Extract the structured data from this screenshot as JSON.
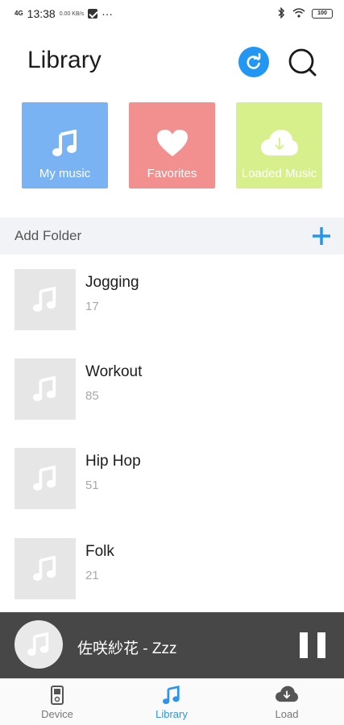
{
  "status_bar": {
    "network": "4G",
    "time": "13:38",
    "net_speed": "0.00 KB/s",
    "more": "···",
    "battery": "100"
  },
  "header": {
    "title": "Library"
  },
  "tiles": [
    {
      "label": "My music",
      "icon": "music-note-icon",
      "color": "#7ab3f4"
    },
    {
      "label": "Favorites",
      "icon": "heart-icon",
      "color": "#f29090"
    },
    {
      "label": "Loaded Music",
      "icon": "cloud-download-icon",
      "color": "#d7f08c"
    }
  ],
  "add_folder": {
    "label": "Add Folder",
    "accent": "#2196f3"
  },
  "playlists": [
    {
      "title": "Jogging",
      "count": "17"
    },
    {
      "title": "Workout",
      "count": "85"
    },
    {
      "title": "Hip Hop",
      "count": "51"
    },
    {
      "title": "Folk",
      "count": "21"
    }
  ],
  "now_playing": {
    "title": "佐咲紗花 - Zzz"
  },
  "bottom_nav": {
    "items": [
      {
        "label": "Device",
        "icon": "device-icon",
        "active": false
      },
      {
        "label": "Library",
        "icon": "music-note-icon",
        "active": true
      },
      {
        "label": "Load",
        "icon": "cloud-download-icon",
        "active": false
      }
    ],
    "active_color": "#2b95ec"
  }
}
